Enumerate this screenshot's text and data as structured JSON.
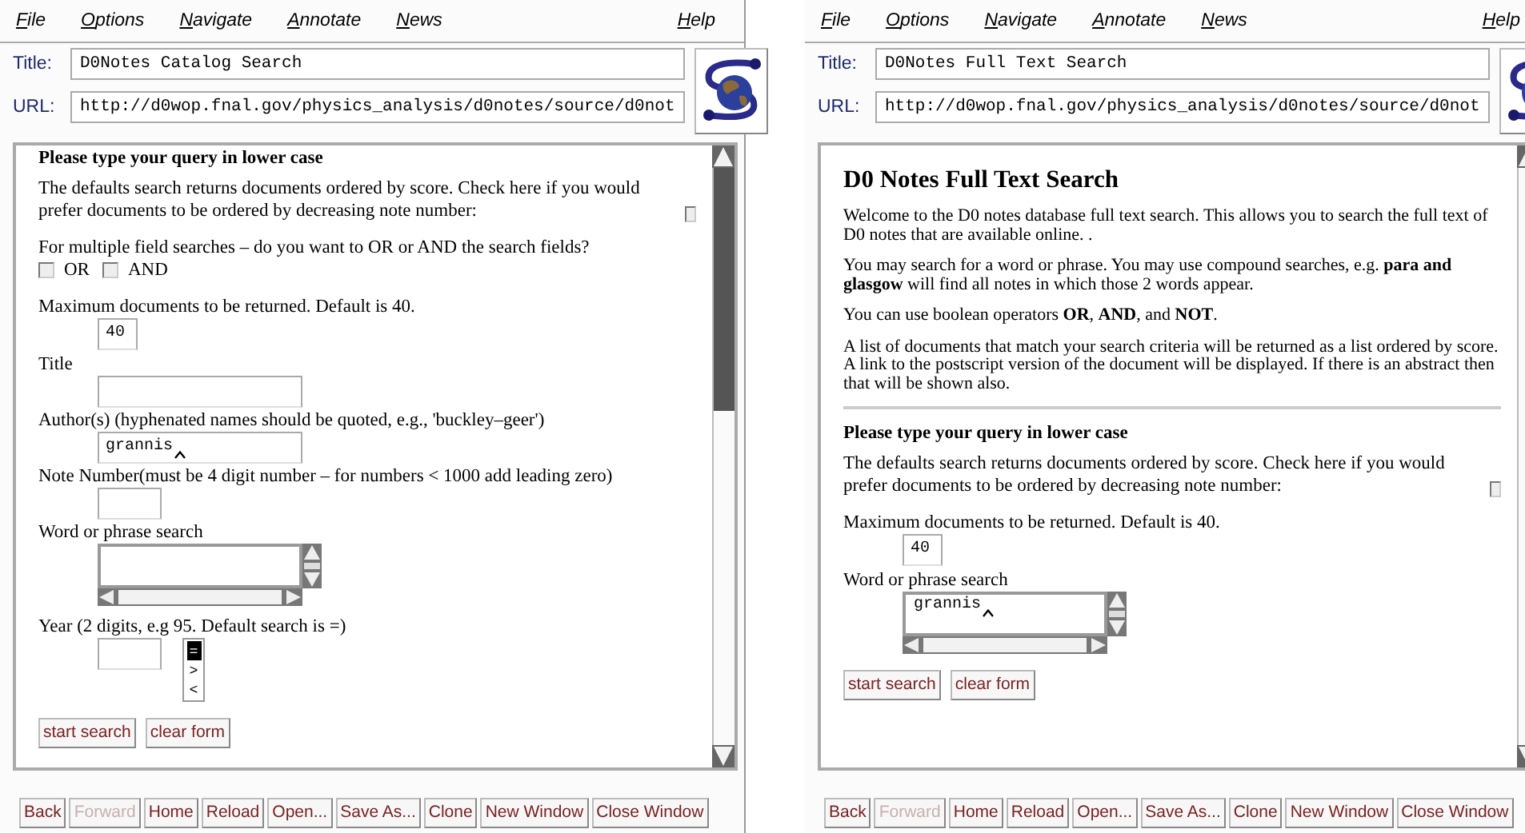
{
  "windows": [
    {
      "menu": [
        "File",
        "Options",
        "Navigate",
        "Annotate",
        "News"
      ],
      "help": "Help",
      "title_label": "Title:",
      "title": "D0Notes Catalog Search",
      "url_label": "URL:",
      "url": "http://d0wop.fnal.gov/physics_analysis/d0notes/source/d0not",
      "content": [
        {
          "kind": "subheading",
          "text": "Please type your query in lower case"
        },
        {
          "kind": "check_paragraph",
          "text": "The defaults search returns documents ordered by score. Check here if you would prefer documents to be ordered by decreasing note number:",
          "checked": false
        },
        {
          "kind": "choice",
          "text": "For multiple field searches – do you want to OR or AND the search fields?",
          "options": [
            {
              "label": "OR",
              "checked": false
            },
            {
              "label": "AND",
              "checked": false
            }
          ]
        },
        {
          "kind": "tiny_field",
          "label": "Maximum documents to be returned. Default is 40.",
          "value": "40"
        },
        {
          "kind": "text_field",
          "label": "Title"
        },
        {
          "kind": "text_field",
          "label": "Author(s) (hyphenated names should be quoted, e.g., 'buckley–geer')",
          "value": "grannis",
          "focused": true
        },
        {
          "kind": "short_field",
          "label": "Note Number(must be 4 digit number – for numbers < 1000 add leading zero)"
        },
        {
          "kind": "text_area",
          "label": "Word or phrase search"
        },
        {
          "kind": "year_field",
          "label": "Year (2 digits, e.g 95. Default search is =)",
          "options": [
            {
              "label": "=",
              "selected": true
            },
            {
              "label": ">",
              "selected": false
            },
            {
              "label": "<",
              "selected": false
            }
          ]
        },
        {
          "kind": "form_buttons",
          "buttons": [
            "start search",
            "clear form"
          ]
        }
      ],
      "buttons": [
        {
          "label": "Back",
          "disabled": false
        },
        {
          "label": "Forward",
          "disabled": true
        },
        {
          "label": "Home",
          "disabled": false
        },
        {
          "label": "Reload",
          "disabled": false
        },
        {
          "label": "Open...",
          "disabled": false
        },
        {
          "label": "Save As...",
          "disabled": false
        },
        {
          "label": "Clone",
          "disabled": false
        },
        {
          "label": "New Window",
          "disabled": false
        },
        {
          "label": "Close Window",
          "disabled": false
        }
      ]
    },
    {
      "menu": [
        "File",
        "Options",
        "Navigate",
        "Annotate",
        "News"
      ],
      "help": "Help",
      "title_label": "Title:",
      "title": "D0Notes Full Text Search",
      "url_label": "URL:",
      "url": "http://d0wop.fnal.gov/physics_analysis/d0notes/source/d0not",
      "content": [
        {
          "kind": "heading",
          "text": "D0 Notes Full Text Search"
        },
        {
          "kind": "intro",
          "text": "Welcome to the D0 notes database full text search. This allows you to search the full text of D0 notes that are available online. ."
        },
        {
          "kind": "intro",
          "text": "You may search for a word or phrase. You may use compound searches, e.g. **para and glasgow** will find all notes in which those 2 words appear."
        },
        {
          "kind": "intro",
          "text": "You can use boolean operators **OR**, **AND**, and **NOT**."
        },
        {
          "kind": "intro",
          "text": "A list of documents that match your search criteria will be returned as a list ordered by score. A link to the postscript version of the document will be displayed. If there is an abstract then that will be shown also."
        },
        {
          "kind": "rule"
        },
        {
          "kind": "subheading",
          "text": "Please type your query in lower case"
        },
        {
          "kind": "check_paragraph",
          "text": "The defaults search returns documents ordered by score. Check here if you would prefer documents to be ordered by decreasing note number:",
          "checked": false
        },
        {
          "kind": "tiny_field",
          "label": "Maximum documents to be returned. Default is 40.",
          "value": "40"
        },
        {
          "kind": "text_area",
          "label": "Word or phrase search",
          "value": "grannis",
          "focused": true
        },
        {
          "kind": "form_buttons",
          "buttons": [
            "start search",
            "clear form"
          ]
        }
      ],
      "buttons": [
        {
          "label": "Back",
          "disabled": false
        },
        {
          "label": "Forward",
          "disabled": true
        },
        {
          "label": "Home",
          "disabled": false
        },
        {
          "label": "Reload",
          "disabled": false
        },
        {
          "label": "Open...",
          "disabled": false
        },
        {
          "label": "Save As...",
          "disabled": false
        },
        {
          "label": "Clone",
          "disabled": false
        },
        {
          "label": "New Window",
          "disabled": false
        },
        {
          "label": "Close Window",
          "disabled": false
        }
      ]
    }
  ]
}
